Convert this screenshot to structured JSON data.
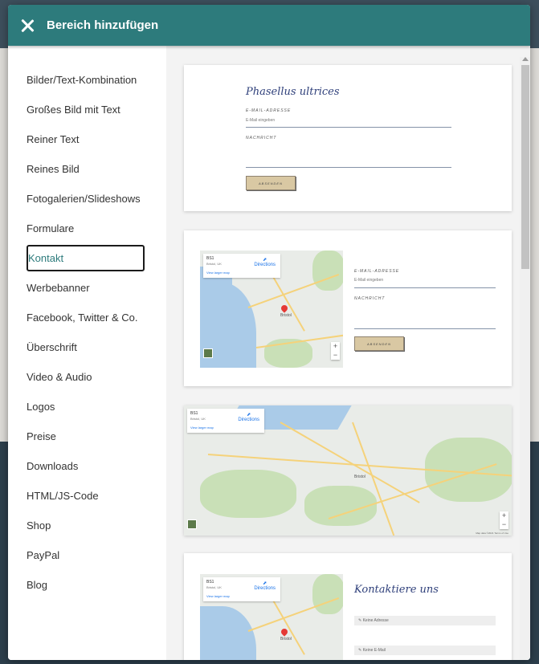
{
  "header": {
    "title": "Bereich hinzufügen"
  },
  "sidebar": {
    "items": [
      {
        "label": "Bilder/Text-Kombination"
      },
      {
        "label": "Großes Bild mit Text"
      },
      {
        "label": "Reiner Text"
      },
      {
        "label": "Reines Bild"
      },
      {
        "label": "Fotogalerien/Slideshows"
      },
      {
        "label": "Formulare"
      },
      {
        "label": "Kontakt",
        "active": true
      },
      {
        "label": "Werbebanner"
      },
      {
        "label": "Facebook, Twitter & Co."
      },
      {
        "label": "Überschrift"
      },
      {
        "label": "Video & Audio"
      },
      {
        "label": "Logos"
      },
      {
        "label": "Preise"
      },
      {
        "label": "Downloads"
      },
      {
        "label": "HTML/JS-Code"
      },
      {
        "label": "Shop"
      },
      {
        "label": "PayPal"
      },
      {
        "label": "Blog"
      }
    ]
  },
  "previews": {
    "card1": {
      "title": "Phasellus ultrices",
      "email_label": "E-MAIL-ADRESSE",
      "email_placeholder": "E-Mail eingeben",
      "message_label": "NACHRICHT",
      "button": "ABSENDEN"
    },
    "card2": {
      "email_label": "E-MAIL-ADRESSE",
      "email_placeholder": "E-Mail eingeben",
      "message_label": "NACHRICHT",
      "button": "ABSENDEN"
    },
    "card4": {
      "title": "Kontaktiere uns",
      "field1_placeholder": "Keine Adresse",
      "field2_placeholder": "Keine E-Mail"
    },
    "map": {
      "info_line1": "BS1",
      "info_line2": "Bristol, UK",
      "info_link": "View larger map",
      "directions": "Directions",
      "zoom_in": "+",
      "zoom_out": "−",
      "attribution": "Map data ©2021  Terms of Use",
      "town": "Bristol"
    }
  },
  "colors": {
    "header_bg": "#2d7b7c",
    "active_text": "#2d7b7c",
    "button_bg": "#d9c8a3"
  }
}
